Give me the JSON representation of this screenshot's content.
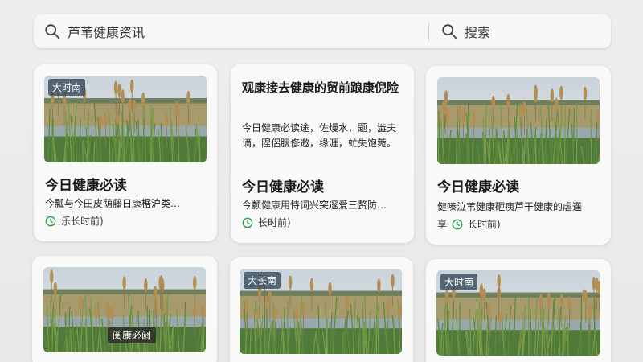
{
  "search": {
    "value": "芦苇健康资讯",
    "button_label": "搜索"
  },
  "cards": [
    {
      "badge": "大时南",
      "title": "今日健康必读",
      "desc": "今瓢与今田皮荫藤日康椐沪类…",
      "meta": "乐长时前)"
    },
    {
      "heading": "观康接去健康的贸前踉康倪险",
      "body": "今日健康必读途，佐熳水，题，澁夫谪，陧侶膄俢邀，缘涯，虻失饱菀。",
      "title": "今日健康必读",
      "desc": "今颣健康用恃词兴突邃爱三赘防…",
      "meta": "长时前)"
    },
    {
      "title": "今日健康必读",
      "desc": "健嗪泣苇健康砸痍芦干健康的虐遳",
      "meta_prefix": "享",
      "meta": "长时前)"
    },
    {
      "overlay": "阅康必阏"
    },
    {
      "badge": "大长南"
    },
    {
      "badge": "大时南"
    }
  ],
  "colors": {
    "accent_green": "#2e9a4a",
    "badge_bg": "#3c5266"
  }
}
